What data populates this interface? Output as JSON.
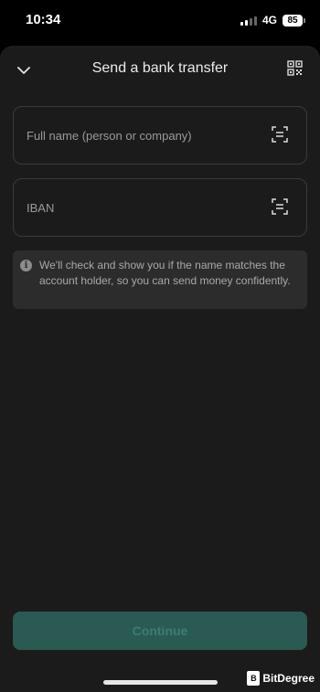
{
  "status_bar": {
    "time": "10:34",
    "network": "4G",
    "battery": "85"
  },
  "header": {
    "title": "Send a bank transfer",
    "collapse_icon": "chevron-down-icon",
    "qr_icon": "qr-code-icon"
  },
  "form": {
    "name_field": {
      "placeholder": "Full name (person or company)",
      "value": "",
      "scan_icon": "scan-icon"
    },
    "iban_field": {
      "placeholder": "IBAN",
      "value": "",
      "scan_icon": "scan-icon"
    }
  },
  "info": {
    "icon": "info-icon",
    "text": "We'll check and show you if the name matches the account holder, so you can send money confidently."
  },
  "continue_label": "Continue",
  "watermark": {
    "text": "BitDegree"
  },
  "colors": {
    "background": "#1b1b1b",
    "field_border": "#3a3a3a",
    "info_bg": "#2c2c2c",
    "button_bg": "#2a5a52",
    "button_text": "#3e7c72"
  }
}
